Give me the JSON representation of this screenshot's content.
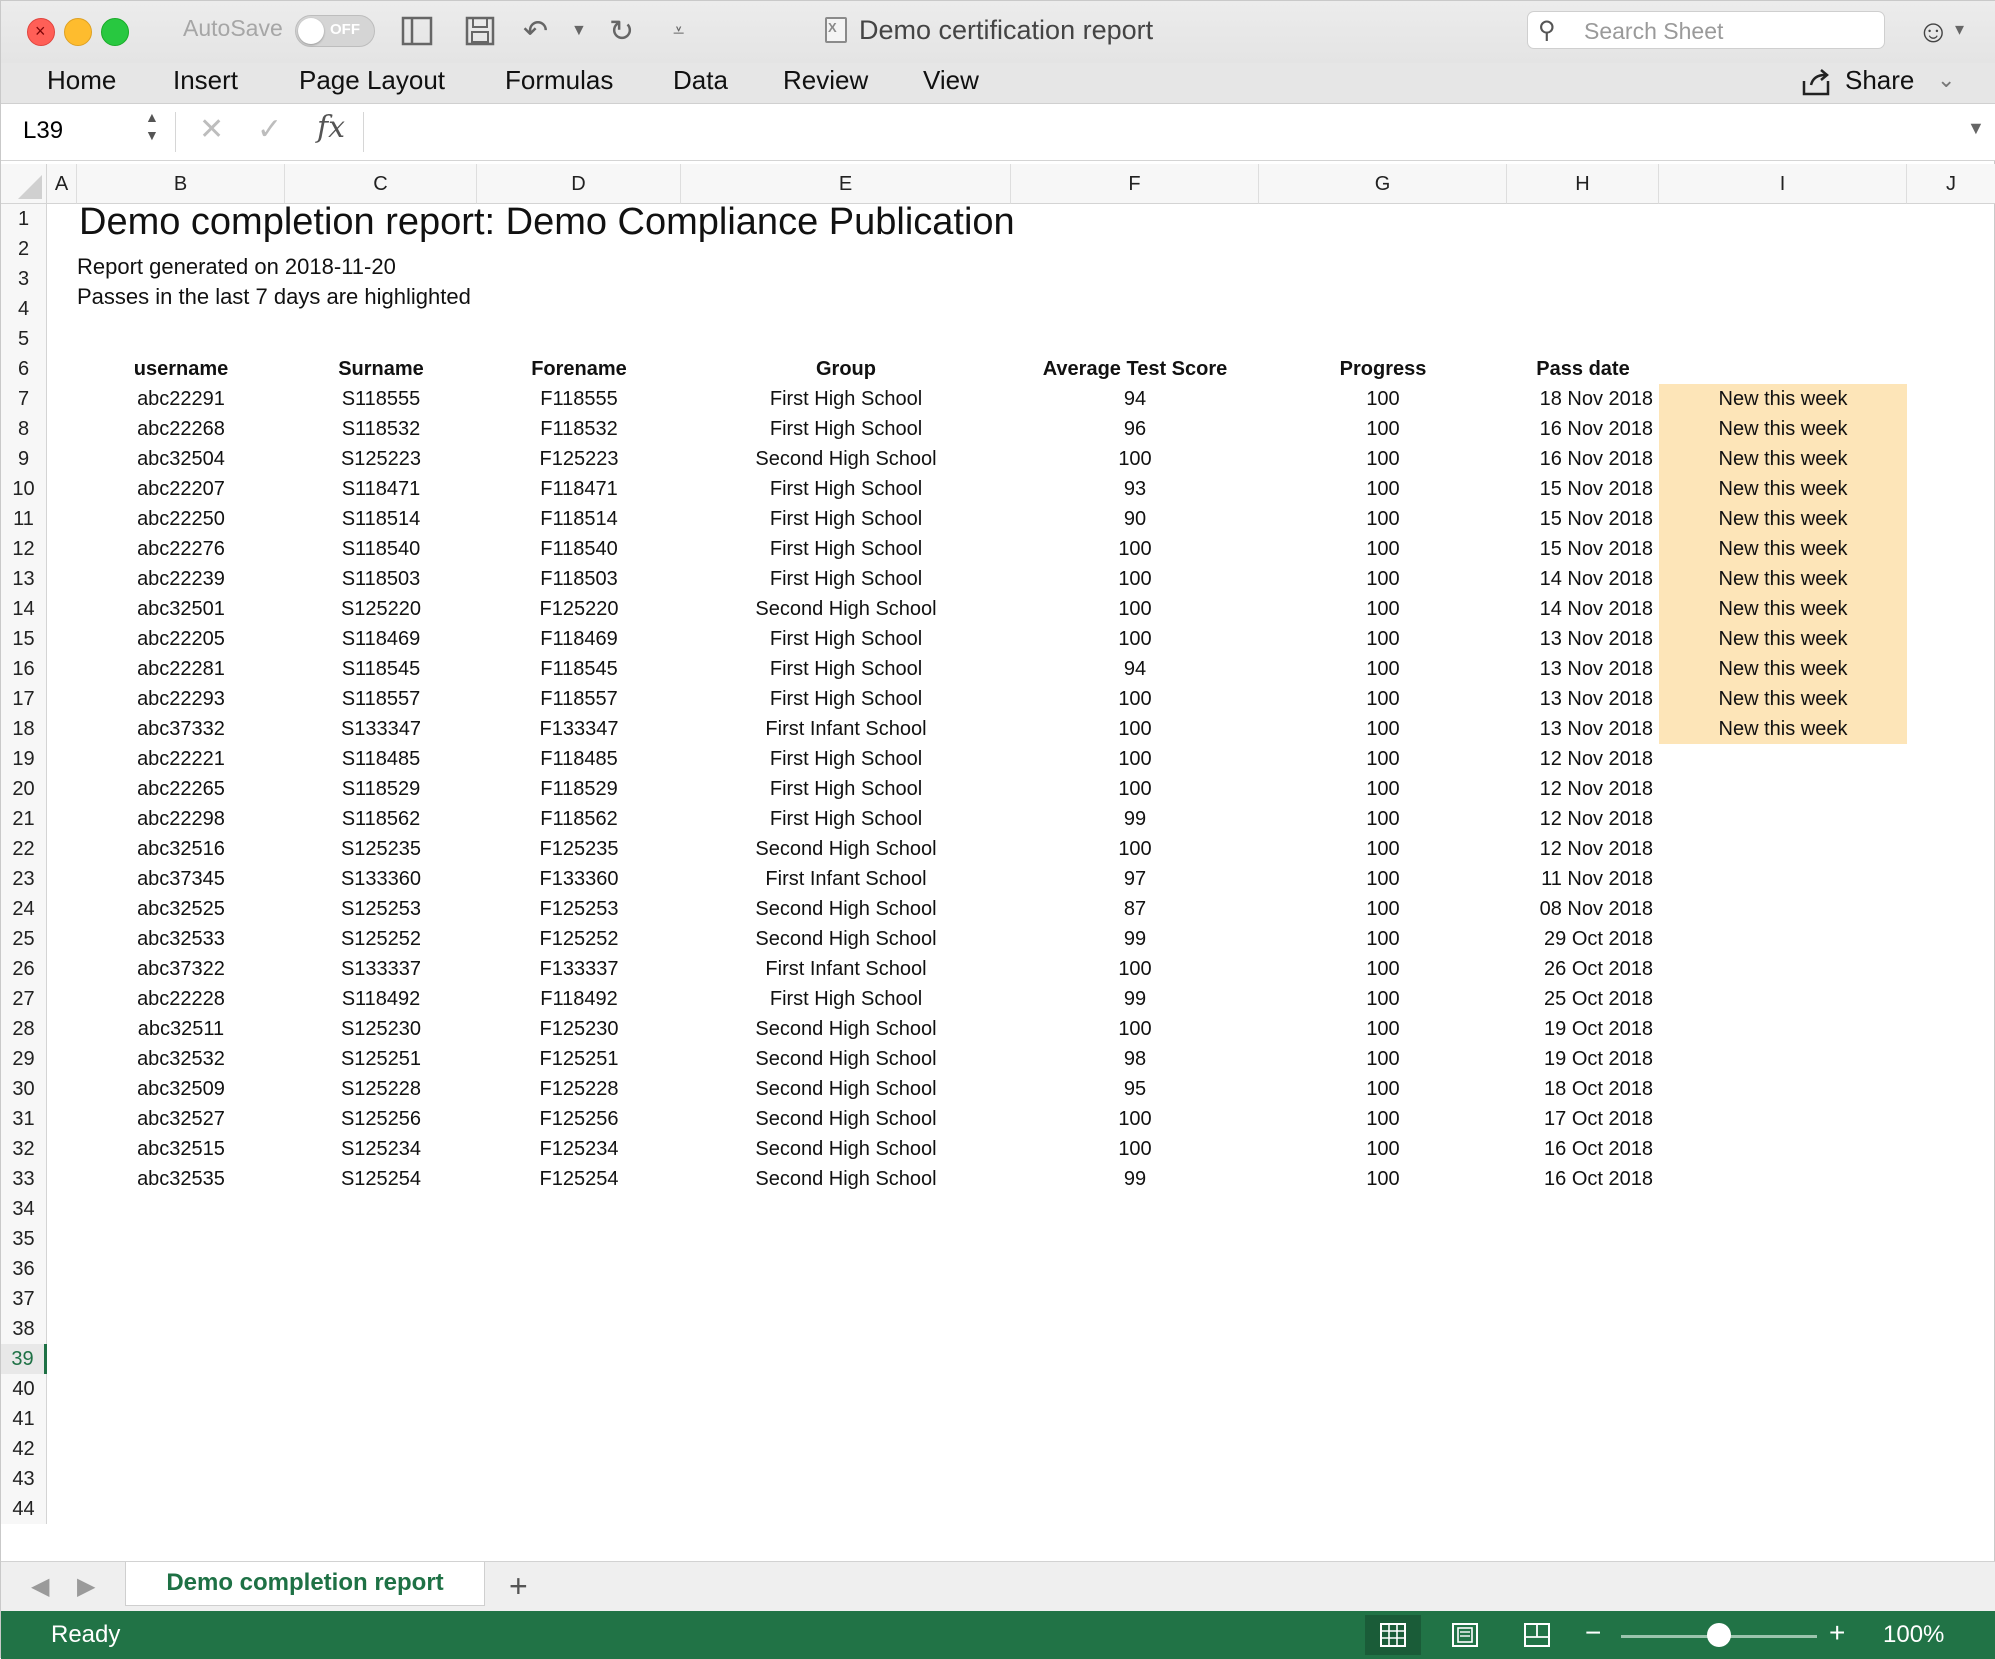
{
  "window": {
    "title": "Demo certification report",
    "autosave_label": "AutoSave",
    "autosave_state": "OFF",
    "search_placeholder": "Search Sheet"
  },
  "ribbon": {
    "tabs": [
      "Home",
      "Insert",
      "Page Layout",
      "Formulas",
      "Data",
      "Review",
      "View"
    ],
    "share_label": "Share"
  },
  "formula_bar": {
    "name_box": "L39",
    "formula": ""
  },
  "columns": [
    "A",
    "B",
    "C",
    "D",
    "E",
    "F",
    "G",
    "H",
    "I",
    "J"
  ],
  "row_numbers": [
    "1",
    "2",
    "3",
    "4",
    "5",
    "6",
    "7",
    "8",
    "9",
    "10",
    "11",
    "12",
    "13",
    "14",
    "15",
    "16",
    "17",
    "18",
    "19",
    "20",
    "21",
    "22",
    "23",
    "24",
    "25",
    "26",
    "27",
    "28",
    "29",
    "30",
    "31",
    "32",
    "33",
    "34",
    "35",
    "36",
    "37",
    "38",
    "39",
    "40",
    "41",
    "42",
    "43",
    "44"
  ],
  "selected_row": "39",
  "sheet": {
    "title": "Demo completion report: Demo Compliance Publication",
    "generated": "Report generated on 2018-11-20",
    "note": "Passes in the last 7 days are highlighted",
    "headers": [
      "username",
      "Surname",
      "Forename",
      "Group",
      "Average Test Score",
      "Progress",
      "Pass date",
      ""
    ],
    "highlight_color": "#fde5b8",
    "rows": [
      [
        "abc22291",
        "S118555",
        "F118555",
        "First High School",
        "94",
        "100",
        "18 Nov 2018",
        "New this week"
      ],
      [
        "abc22268",
        "S118532",
        "F118532",
        "First High School",
        "96",
        "100",
        "16 Nov 2018",
        "New this week"
      ],
      [
        "abc32504",
        "S125223",
        "F125223",
        "Second High School",
        "100",
        "100",
        "16 Nov 2018",
        "New this week"
      ],
      [
        "abc22207",
        "S118471",
        "F118471",
        "First High School",
        "93",
        "100",
        "15 Nov 2018",
        "New this week"
      ],
      [
        "abc22250",
        "S118514",
        "F118514",
        "First High School",
        "90",
        "100",
        "15 Nov 2018",
        "New this week"
      ],
      [
        "abc22276",
        "S118540",
        "F118540",
        "First High School",
        "100",
        "100",
        "15 Nov 2018",
        "New this week"
      ],
      [
        "abc22239",
        "S118503",
        "F118503",
        "First High School",
        "100",
        "100",
        "14 Nov 2018",
        "New this week"
      ],
      [
        "abc32501",
        "S125220",
        "F125220",
        "Second High School",
        "100",
        "100",
        "14 Nov 2018",
        "New this week"
      ],
      [
        "abc22205",
        "S118469",
        "F118469",
        "First High School",
        "100",
        "100",
        "13 Nov 2018",
        "New this week"
      ],
      [
        "abc22281",
        "S118545",
        "F118545",
        "First High School",
        "94",
        "100",
        "13 Nov 2018",
        "New this week"
      ],
      [
        "abc22293",
        "S118557",
        "F118557",
        "First High School",
        "100",
        "100",
        "13 Nov 2018",
        "New this week"
      ],
      [
        "abc37332",
        "S133347",
        "F133347",
        "First Infant School",
        "100",
        "100",
        "13 Nov 2018",
        "New this week"
      ],
      [
        "abc22221",
        "S118485",
        "F118485",
        "First High School",
        "100",
        "100",
        "12 Nov 2018",
        ""
      ],
      [
        "abc22265",
        "S118529",
        "F118529",
        "First High School",
        "100",
        "100",
        "12 Nov 2018",
        ""
      ],
      [
        "abc22298",
        "S118562",
        "F118562",
        "First High School",
        "99",
        "100",
        "12 Nov 2018",
        ""
      ],
      [
        "abc32516",
        "S125235",
        "F125235",
        "Second High School",
        "100",
        "100",
        "12 Nov 2018",
        ""
      ],
      [
        "abc37345",
        "S133360",
        "F133360",
        "First Infant School",
        "97",
        "100",
        "11 Nov 2018",
        ""
      ],
      [
        "abc32525",
        "S125253",
        "F125253",
        "Second High School",
        "87",
        "100",
        "08 Nov 2018",
        ""
      ],
      [
        "abc32533",
        "S125252",
        "F125252",
        "Second High School",
        "99",
        "100",
        "29 Oct 2018",
        ""
      ],
      [
        "abc37322",
        "S133337",
        "F133337",
        "First Infant School",
        "100",
        "100",
        "26 Oct 2018",
        ""
      ],
      [
        "abc22228",
        "S118492",
        "F118492",
        "First High School",
        "99",
        "100",
        "25 Oct 2018",
        ""
      ],
      [
        "abc32511",
        "S125230",
        "F125230",
        "Second High School",
        "100",
        "100",
        "19 Oct 2018",
        ""
      ],
      [
        "abc32532",
        "S125251",
        "F125251",
        "Second High School",
        "98",
        "100",
        "19 Oct 2018",
        ""
      ],
      [
        "abc32509",
        "S125228",
        "F125228",
        "Second High School",
        "95",
        "100",
        "18 Oct 2018",
        ""
      ],
      [
        "abc32527",
        "S125256",
        "F125256",
        "Second High School",
        "100",
        "100",
        "17 Oct 2018",
        ""
      ],
      [
        "abc32515",
        "S125234",
        "F125234",
        "Second High School",
        "100",
        "100",
        "16 Oct 2018",
        ""
      ],
      [
        "abc32535",
        "S125254",
        "F125254",
        "Second High School",
        "99",
        "100",
        "16 Oct 2018",
        ""
      ]
    ]
  },
  "sheet_tabs": [
    "Demo completion report"
  ],
  "status": {
    "text": "Ready",
    "zoom": "100%",
    "zoom_level": 1.0
  }
}
